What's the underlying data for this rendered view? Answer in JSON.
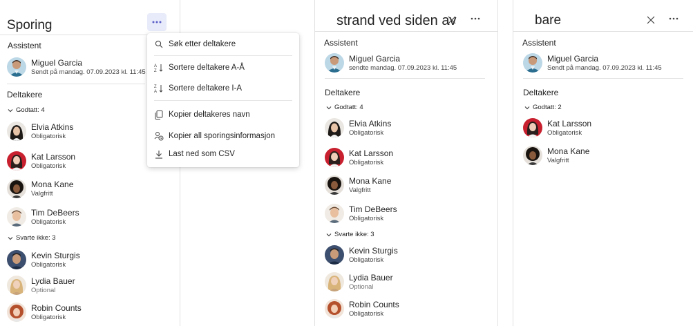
{
  "panel1": {
    "title": "Sporing",
    "assistant_label": "Assistent",
    "assistant": {
      "name": "Miguel Garcia",
      "status": "Sendt på mandag. 07.09.2023 kl. 11:45 A"
    },
    "participants_label": "Deltakere",
    "accepted_label": "Godtatt: 4",
    "accepted": [
      {
        "name": "Elvia Atkins",
        "status": "Obligatorisk"
      },
      {
        "name": "Kat Larsson",
        "status": "Obligatorisk"
      },
      {
        "name": "Mona Kane",
        "status": "Valgfritt"
      },
      {
        "name": "Tim DeBeers",
        "status": "Obligatorisk"
      }
    ],
    "noreply_label": "Svarte ikke: 3",
    "noreply": [
      {
        "name": "Kevin Sturgis",
        "status": "Obligatorisk"
      },
      {
        "name": "Lydia Bauer",
        "status": "Optional"
      },
      {
        "name": "Robin Counts",
        "status": "Obligatorisk"
      }
    ]
  },
  "menu": {
    "items": [
      {
        "label": "Søk etter deltakere",
        "icon": "search-icon"
      },
      {
        "label": "Sortere deltakere A-Å",
        "icon": "sort-ascending-icon"
      },
      {
        "label": "Sortere deltakere I-A",
        "icon": "sort-descending-icon"
      },
      {
        "label": "Kopier deltakeres navn",
        "icon": "copy-icon"
      },
      {
        "label": "Kopier all sporingsinformasjon",
        "icon": "copy-info-icon"
      },
      {
        "label": "Last ned som CSV",
        "icon": "download-icon"
      }
    ]
  },
  "panel2": {
    "title": "strand ved siden av",
    "assistant_label": "Assistent",
    "assistant": {
      "name": "Miguel Garcia",
      "status": "sendte mandag. 07.09.2023 kl. 11:45"
    },
    "participants_label": "Deltakere",
    "accepted_label": "Godtatt: 4",
    "accepted": [
      {
        "name": "Elvia Atkins",
        "status": "Obligatorisk"
      },
      {
        "name": "Kat Larsson",
        "status": "Obligatorisk"
      },
      {
        "name": "Mona Kane",
        "status": "Valgfritt"
      },
      {
        "name": "Tim DeBeers",
        "status": "Obligatorisk"
      }
    ],
    "noreply_label": "Svarte ikke: 3",
    "noreply": [
      {
        "name": "Kevin Sturgis",
        "status": "Obligatorisk"
      },
      {
        "name": "Lydia Bauer",
        "status": "Optional"
      },
      {
        "name": "Robin Counts",
        "status": "Obligatorisk"
      }
    ]
  },
  "panel3": {
    "title": "bare",
    "assistant_label": "Assistent",
    "assistant": {
      "name": "Miguel Garcia",
      "status": "Sendt på mandag. 07.09.2023 kl. 11:45"
    },
    "participants_label": "Deltakere",
    "accepted_label": "Godtatt: 2",
    "accepted": [
      {
        "name": "Kat Larsson",
        "status": "Obligatorisk"
      },
      {
        "name": "Mona Kane",
        "status": "Valgfritt"
      }
    ]
  },
  "colors": {
    "accent": "#5b5fc7",
    "accent_bg": "#e8ebfa",
    "divider": "#e1e1e1"
  }
}
